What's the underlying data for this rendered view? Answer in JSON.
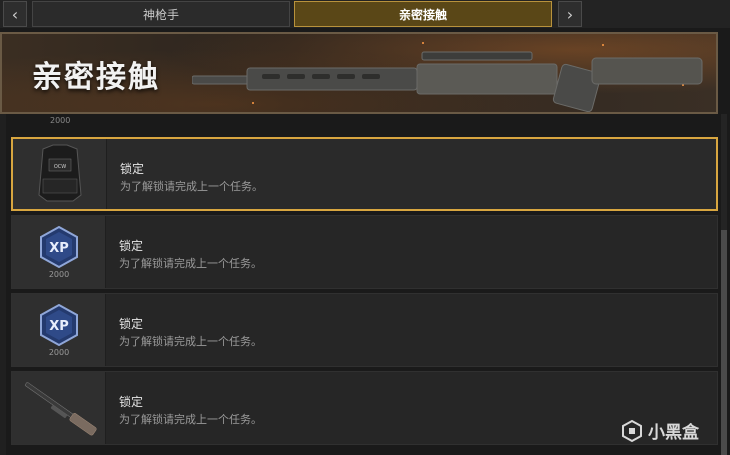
{
  "tabs": [
    {
      "label": "神枪手",
      "active": false
    },
    {
      "label": "亲密接触",
      "active": true
    }
  ],
  "nav": {
    "prev_icon": "chevron-left-icon",
    "next_icon": "chevron-right-icon"
  },
  "banner": {
    "title": "亲密接触"
  },
  "partial_item": {
    "label": "2000"
  },
  "items": [
    {
      "title": "锁定",
      "desc": "为了解锁请完成上一个任务。",
      "reward": "vest",
      "reward_label": "",
      "selected": true
    },
    {
      "title": "锁定",
      "desc": "为了解锁请完成上一个任务。",
      "reward": "xp",
      "reward_label": "2000",
      "selected": false
    },
    {
      "title": "锁定",
      "desc": "为了解锁请完成上一个任务。",
      "reward": "xp",
      "reward_label": "2000",
      "selected": false
    },
    {
      "title": "锁定",
      "desc": "为了解锁请完成上一个任务。",
      "reward": "shotgun",
      "reward_label": "",
      "selected": false
    }
  ],
  "watermark": {
    "text": "小黑盒"
  },
  "colors": {
    "accent": "#d8a640",
    "active_tab_bg": "#5a4717",
    "background": "#1a1a1a"
  }
}
